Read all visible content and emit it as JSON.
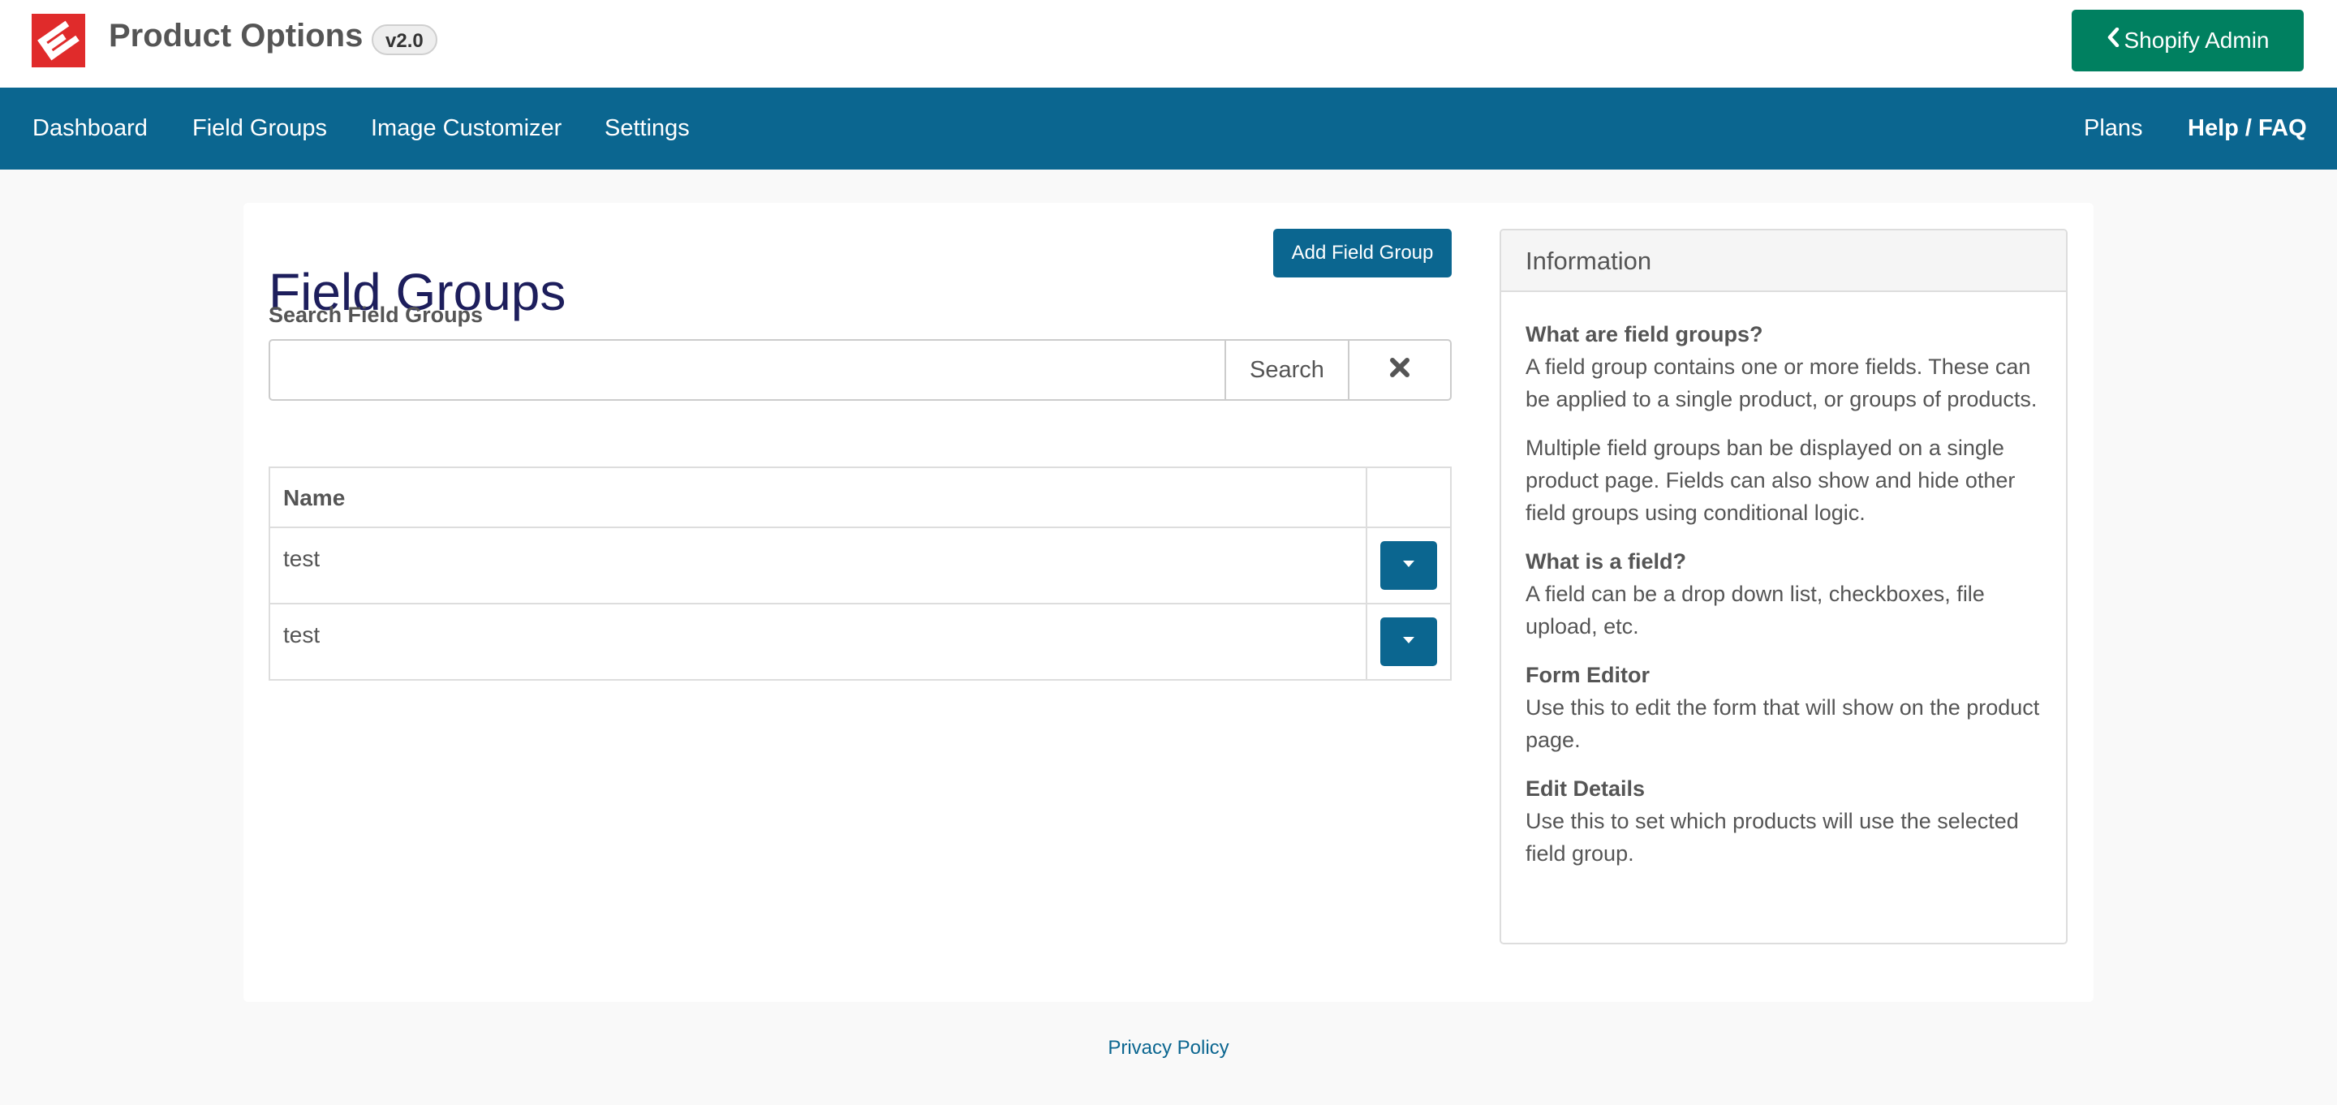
{
  "header": {
    "app_title": "Product Options",
    "version": "v2.0",
    "logo_icon": "ep-logo-icon",
    "shopify_admin_label": "Shopify Admin",
    "shopify_admin_icon": "chevron-left-icon"
  },
  "nav": {
    "left_items": [
      {
        "label": "Dashboard"
      },
      {
        "label": "Field Groups"
      },
      {
        "label": "Image Customizer"
      },
      {
        "label": "Settings"
      }
    ],
    "right_items": [
      {
        "label": "Plans"
      },
      {
        "label": "Help / FAQ"
      }
    ]
  },
  "main": {
    "title": "Field Groups",
    "add_button_label": "Add Field Group",
    "search": {
      "label": "Search Field Groups",
      "value": "",
      "placeholder": "",
      "button_label": "Search",
      "clear_icon": "close-icon"
    },
    "table": {
      "columns": [
        "Name",
        ""
      ],
      "rows": [
        {
          "name": "test"
        },
        {
          "name": "test"
        }
      ],
      "row_action_icon": "caret-down-icon"
    }
  },
  "info_panel": {
    "heading": "Information",
    "blocks": [
      {
        "title": "What are field groups?",
        "text": "A field group contains one or more fields. These can be applied to a single product, or groups of products."
      },
      {
        "title": "",
        "text": "Multiple field groups ban be displayed on a single product page. Fields can also show and hide other field groups using conditional logic."
      },
      {
        "title": "What is a field?",
        "text": "A field can be a drop down list, checkboxes, file upload, etc."
      },
      {
        "title": "Form Editor",
        "text": "Use this to edit the form that will show on the product page."
      },
      {
        "title": "Edit Details",
        "text": "Use this to set which products will use the selected field group."
      }
    ]
  },
  "footer": {
    "privacy_label": "Privacy Policy"
  },
  "colors": {
    "nav_background": "#0b6690",
    "primary_button": "#0b6690",
    "shopify_button": "#008060",
    "logo_red": "#e02b2b",
    "title_color": "#1d1e5c",
    "page_background": "#f9f9f9"
  }
}
